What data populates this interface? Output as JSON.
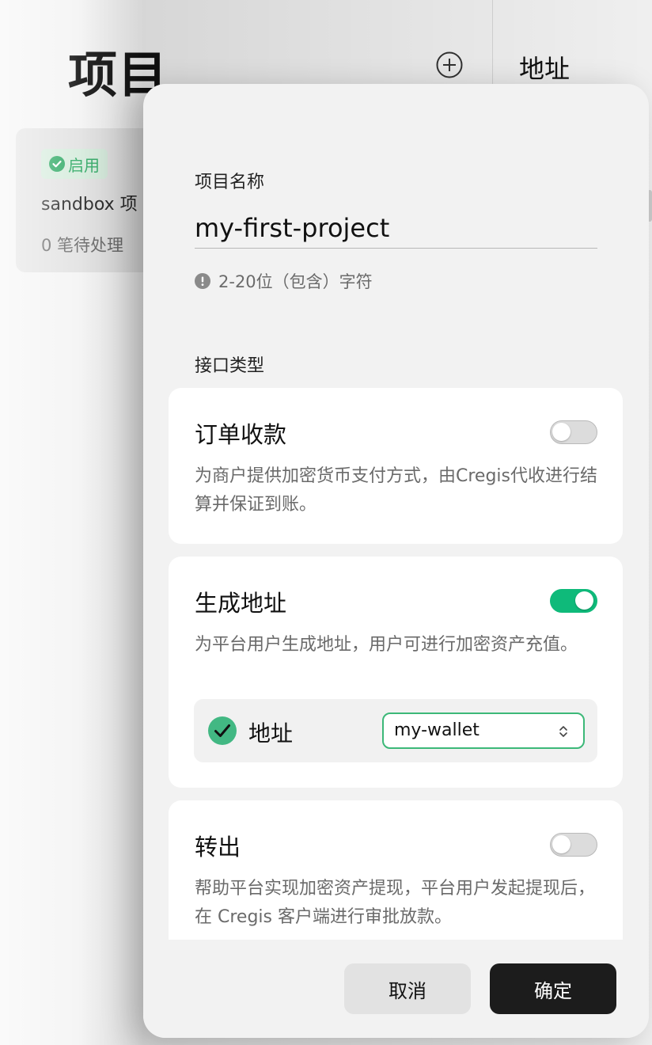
{
  "background": {
    "title": "项目",
    "right_title": "地址",
    "project_card": {
      "status": "启用",
      "name": "sandbox 项",
      "pending": "0 笔待处理"
    }
  },
  "modal": {
    "name_label": "项目名称",
    "name_value": "my-first-project",
    "name_hint": "2-20位（包含）字符",
    "api_type_label": "接口类型",
    "options": [
      {
        "title": "订单收款",
        "description": "为商户提供加密货币支付方式，由Cregis代收进行结算并保证到账。",
        "enabled": false
      },
      {
        "title": "生成地址",
        "description": "为平台用户生成地址，用户可进行加密资产充值。",
        "enabled": true,
        "address": {
          "label": "地址",
          "checked": true,
          "wallet": "my-wallet"
        }
      },
      {
        "title": "转出",
        "description": "帮助平台实现加密资产提现，平台用户发起提现后，在 Cregis 客户端进行审批放款。",
        "enabled": false
      }
    ],
    "cancel_label": "取消",
    "confirm_label": "确定"
  },
  "colors": {
    "accent_green": "#0fba7a",
    "status_green": "#2ba862",
    "primary_button": "#1c1c1c"
  },
  "icons": {
    "add": "plus-circle-icon",
    "status": "check-circle-icon",
    "hint": "exclamation-circle-icon",
    "address_check": "check-circle-filled-icon",
    "select": "chevron-up-down-icon"
  }
}
